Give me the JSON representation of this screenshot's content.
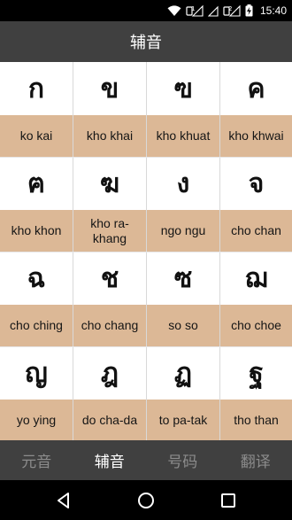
{
  "status_bar": {
    "time": "15:40",
    "sim1": "1",
    "sim2": "2"
  },
  "header": {
    "title": "辅音"
  },
  "consonants": [
    {
      "glyph": "ก",
      "label": "ko kai"
    },
    {
      "glyph": "ข",
      "label": "kho khai"
    },
    {
      "glyph": "ฃ",
      "label": "kho khuat"
    },
    {
      "glyph": "ค",
      "label": "kho khwai"
    },
    {
      "glyph": "ฅ",
      "label": "kho khon"
    },
    {
      "glyph": "ฆ",
      "label": "kho ra-khang"
    },
    {
      "glyph": "ง",
      "label": "ngo ngu"
    },
    {
      "glyph": "จ",
      "label": "cho chan"
    },
    {
      "glyph": "ฉ",
      "label": "cho ching"
    },
    {
      "glyph": "ช",
      "label": "cho chang"
    },
    {
      "glyph": "ซ",
      "label": "so so"
    },
    {
      "glyph": "ฌ",
      "label": "cho choe"
    },
    {
      "glyph": "ญ",
      "label": "yo ying"
    },
    {
      "glyph": "ฎ",
      "label": "do cha-da"
    },
    {
      "glyph": "ฏ",
      "label": "to pa-tak"
    },
    {
      "glyph": "ฐ",
      "label": "tho than"
    }
  ],
  "tabs": [
    {
      "label": "元音",
      "active": false
    },
    {
      "label": "辅音",
      "active": true
    },
    {
      "label": "号码",
      "active": false
    },
    {
      "label": "翻译",
      "active": false
    }
  ],
  "colors": {
    "header_bg": "#404040",
    "label_bg": "#dcb896",
    "tab_active": "#ffffff",
    "tab_inactive": "#8c8c8c"
  }
}
